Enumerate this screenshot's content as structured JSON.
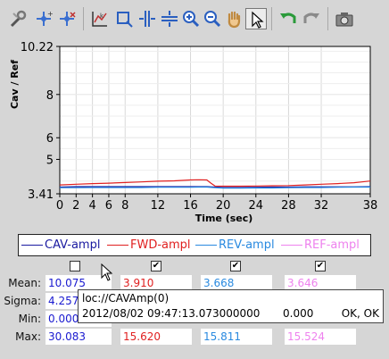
{
  "toolbar": {
    "buttons": [
      {
        "name": "zoom-settings-icon"
      },
      {
        "name": "add-marker-icon"
      },
      {
        "name": "remove-marker-icon"
      },
      {
        "name": "axis-scale-icon"
      },
      {
        "name": "zoom-box-icon"
      },
      {
        "name": "horizontal-zoom-icon"
      },
      {
        "name": "vertical-zoom-icon"
      },
      {
        "name": "zoom-in-icon"
      },
      {
        "name": "zoom-out-icon"
      },
      {
        "name": "pan-hand-icon"
      },
      {
        "name": "select-arrow-icon"
      },
      {
        "name": "undo-icon"
      },
      {
        "name": "redo-icon"
      },
      {
        "name": "snapshot-camera-icon"
      }
    ]
  },
  "chart_data": {
    "type": "line",
    "xlabel": "Time (sec)",
    "ylabel": "Cav / Ref",
    "xlim": [
      0,
      38
    ],
    "ylim": [
      3.41,
      10.22
    ],
    "xticks": [
      "0",
      "2",
      "4",
      "6",
      "8",
      "12",
      "16",
      "20",
      "24",
      "28",
      "32",
      "38"
    ],
    "xtick_values": [
      0,
      2,
      4,
      6,
      8,
      12,
      16,
      20,
      24,
      28,
      32,
      38
    ],
    "yticks": [
      "10.22",
      "8",
      "6",
      "5",
      "3.41"
    ],
    "ytick_values": [
      10.22,
      8,
      6,
      5,
      3.41
    ],
    "grid": true,
    "series": [
      {
        "name": "CAV-ampl",
        "color": "#1a1aa0",
        "x": [
          0,
          2,
          4,
          6,
          8,
          10,
          12,
          14,
          16,
          17,
          18,
          19,
          20,
          22,
          24,
          26,
          28,
          30,
          32,
          34,
          36,
          38
        ],
        "y": [
          3.72,
          3.74,
          3.74,
          3.74,
          3.74,
          3.74,
          3.74,
          3.74,
          3.74,
          3.74,
          3.74,
          3.72,
          3.7,
          3.7,
          3.71,
          3.72,
          3.72,
          3.73,
          3.73,
          3.73,
          3.73,
          3.74
        ]
      },
      {
        "name": "FWD-ampl",
        "color": "#e02020",
        "x": [
          0,
          2,
          4,
          6,
          8,
          10,
          12,
          14,
          16,
          17,
          18,
          18.5,
          19,
          20,
          22,
          24,
          26,
          28,
          30,
          32,
          34,
          36,
          37,
          38
        ],
        "y": [
          3.82,
          3.85,
          3.88,
          3.9,
          3.93,
          3.96,
          3.99,
          4.01,
          4.05,
          4.06,
          4.05,
          3.9,
          3.77,
          3.76,
          3.76,
          3.77,
          3.78,
          3.79,
          3.82,
          3.85,
          3.88,
          3.92,
          3.96,
          4.0
        ]
      },
      {
        "name": "REV-ampl",
        "color": "#2a8ae0",
        "x": [
          0,
          2,
          4,
          6,
          8,
          10,
          12,
          14,
          16,
          17,
          18,
          19,
          20,
          22,
          24,
          26,
          28,
          30,
          32,
          34,
          36,
          38
        ],
        "y": [
          3.69,
          3.69,
          3.7,
          3.7,
          3.7,
          3.7,
          3.71,
          3.71,
          3.71,
          3.72,
          3.72,
          3.69,
          3.67,
          3.67,
          3.68,
          3.68,
          3.69,
          3.7,
          3.7,
          3.71,
          3.72,
          3.72
        ]
      },
      {
        "name": "REF-ampl",
        "color": "#ee82ee",
        "x": [],
        "y": []
      }
    ]
  },
  "legend": [
    {
      "name": "CAV-ampl",
      "color": "#1a1aa0"
    },
    {
      "name": "FWD-ampl",
      "color": "#e02020"
    },
    {
      "name": "REV-ampl",
      "color": "#2a8ae0"
    },
    {
      "name": "REF-ampl",
      "color": "#ee82ee"
    }
  ],
  "checkboxes": [
    {
      "checked": false,
      "mark": ""
    },
    {
      "checked": true,
      "mark": "✔"
    },
    {
      "checked": true,
      "mark": "✔"
    },
    {
      "checked": true,
      "mark": "✔"
    }
  ],
  "stats": {
    "labels": {
      "mean": "Mean:",
      "sigma": "Sigma:",
      "min": "Min:",
      "max": "Max:"
    },
    "cav": {
      "mean": "10.075",
      "sigma": "4.257",
      "min": "0.000",
      "max": "30.083",
      "color": "#1a1ad0"
    },
    "fwd": {
      "mean": "3.910",
      "max": "15.620",
      "color": "#e02020"
    },
    "rev": {
      "mean": "3.668",
      "max": "15.811",
      "color": "#2a8ae0"
    },
    "ref": {
      "mean": "3.646",
      "max": "15.524",
      "color": "#ee82ee"
    }
  },
  "tooltip": {
    "line1": "loc://CAVAmp(0)",
    "timestamp": "2012/08/02 09:47:13.073000000",
    "value": "0.000",
    "status": "OK, OK"
  }
}
